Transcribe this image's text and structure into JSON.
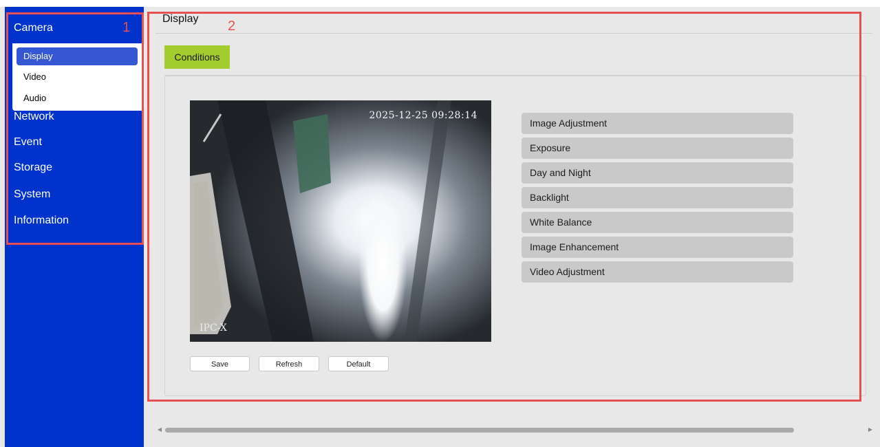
{
  "sidebar": {
    "categories": [
      "Camera",
      "Network",
      "Event",
      "Storage",
      "System",
      "Information"
    ],
    "camera_subitems": [
      "Display",
      "Video",
      "Audio"
    ],
    "active_subitem": "Display"
  },
  "annotations": {
    "box1_number": "1",
    "box2_number": "2"
  },
  "main": {
    "title": "Display",
    "tab": "Conditions",
    "video": {
      "timestamp": "2025-12-25  09:28:14",
      "camera_label": "IPC-X"
    },
    "buttons": {
      "save": "Save",
      "refresh": "Refresh",
      "default": "Default"
    },
    "settings": [
      "Image Adjustment",
      "Exposure",
      "Day and Night",
      "Backlight",
      "White Balance",
      "Image Enhancement",
      "Video Adjustment"
    ]
  },
  "colors": {
    "sidebar_bg": "#0033cc",
    "active_item": "#3557d4",
    "tab_green": "#a3cc2e",
    "annotation_red": "#e65050"
  }
}
